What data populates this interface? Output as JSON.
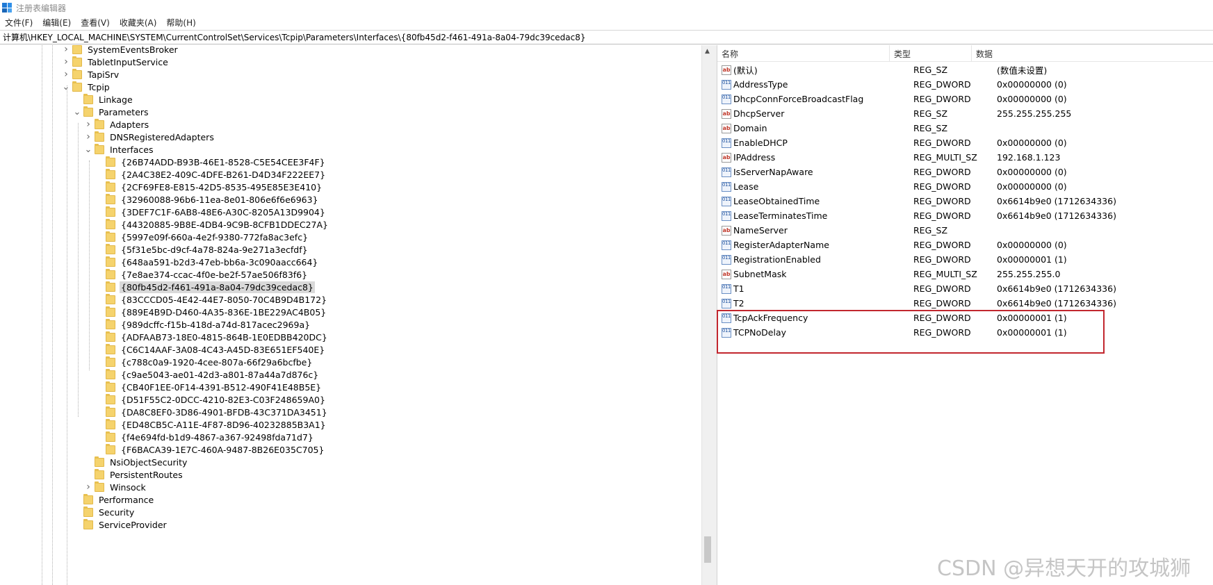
{
  "window": {
    "title": "注册表编辑器"
  },
  "menu": [
    "文件(F)",
    "编辑(E)",
    "查看(V)",
    "收藏夹(A)",
    "帮助(H)"
  ],
  "address": "计算机\\HKEY_LOCAL_MACHINE\\SYSTEM\\CurrentControlSet\\Services\\Tcpip\\Parameters\\Interfaces\\{80fb45d2-f461-491a-8a04-79dc39cedac8}",
  "tree": [
    {
      "label": "SystemEventsBroker",
      "depth": 0,
      "expander": "collapsed"
    },
    {
      "label": "TabletInputService",
      "depth": 0,
      "expander": "collapsed"
    },
    {
      "label": "TapiSrv",
      "depth": 0,
      "expander": "collapsed"
    },
    {
      "label": "Tcpip",
      "depth": 0,
      "expander": "expanded"
    },
    {
      "label": "Linkage",
      "depth": 1,
      "expander": "none"
    },
    {
      "label": "Parameters",
      "depth": 1,
      "expander": "expanded"
    },
    {
      "label": "Adapters",
      "depth": 2,
      "expander": "collapsed"
    },
    {
      "label": "DNSRegisteredAdapters",
      "depth": 2,
      "expander": "collapsed"
    },
    {
      "label": "Interfaces",
      "depth": 2,
      "expander": "expanded"
    },
    {
      "label": "{26B74ADD-B93B-46E1-8528-C5E54CEE3F4F}",
      "depth": 3,
      "expander": "none"
    },
    {
      "label": "{2A4C38E2-409C-4DFE-B261-D4D34F222EE7}",
      "depth": 3,
      "expander": "none"
    },
    {
      "label": "{2CF69FE8-E815-42D5-8535-495E85E3E410}",
      "depth": 3,
      "expander": "none"
    },
    {
      "label": "{32960088-96b6-11ea-8e01-806e6f6e6963}",
      "depth": 3,
      "expander": "none"
    },
    {
      "label": "{3DEF7C1F-6AB8-48E6-A30C-8205A13D9904}",
      "depth": 3,
      "expander": "none"
    },
    {
      "label": "{44320885-9B8E-4DB4-9C9B-8CFB1DDEC27A}",
      "depth": 3,
      "expander": "none"
    },
    {
      "label": "{5997e09f-660a-4e2f-9380-772fa8ac3efc}",
      "depth": 3,
      "expander": "none"
    },
    {
      "label": "{5f31e5bc-d9cf-4a78-824a-9e271a3ecfdf}",
      "depth": 3,
      "expander": "none"
    },
    {
      "label": "{648aa591-b2d3-47eb-bb6a-3c090aacc664}",
      "depth": 3,
      "expander": "none"
    },
    {
      "label": "{7e8ae374-ccac-4f0e-be2f-57ae506f83f6}",
      "depth": 3,
      "expander": "none"
    },
    {
      "label": "{80fb45d2-f461-491a-8a04-79dc39cedac8}",
      "depth": 3,
      "expander": "none",
      "selected": true
    },
    {
      "label": "{83CCCD05-4E42-44E7-8050-70C4B9D4B172}",
      "depth": 3,
      "expander": "none"
    },
    {
      "label": "{889E4B9D-D460-4A35-836E-1BE229AC4B05}",
      "depth": 3,
      "expander": "none"
    },
    {
      "label": "{989dcffc-f15b-418d-a74d-817acec2969a}",
      "depth": 3,
      "expander": "none"
    },
    {
      "label": "{ADFAAB73-18E0-4815-864B-1E0EDBB420DC}",
      "depth": 3,
      "expander": "none"
    },
    {
      "label": "{C6C14AAF-3A08-4C43-A45D-83E651EF540E}",
      "depth": 3,
      "expander": "none"
    },
    {
      "label": "{c788c0a9-1920-4cee-807a-66f29a6bcfbe}",
      "depth": 3,
      "expander": "none"
    },
    {
      "label": "{c9ae5043-ae01-42d3-a801-87a44a7d876c}",
      "depth": 3,
      "expander": "none"
    },
    {
      "label": "{CB40F1EE-0F14-4391-B512-490F41E48B5E}",
      "depth": 3,
      "expander": "none"
    },
    {
      "label": "{D51F55C2-0DCC-4210-82E3-C03F248659A0}",
      "depth": 3,
      "expander": "none"
    },
    {
      "label": "{DA8C8EF0-3D86-4901-BFDB-43C371DA3451}",
      "depth": 3,
      "expander": "none"
    },
    {
      "label": "{ED48CB5C-A11E-4F87-8D96-40232885B3A1}",
      "depth": 3,
      "expander": "none"
    },
    {
      "label": "{f4e694fd-b1d9-4867-a367-92498fda71d7}",
      "depth": 3,
      "expander": "none"
    },
    {
      "label": "{F6BACA39-1E7C-460A-9487-8B26E035C705}",
      "depth": 3,
      "expander": "none"
    },
    {
      "label": "NsiObjectSecurity",
      "depth": 2,
      "expander": "none"
    },
    {
      "label": "PersistentRoutes",
      "depth": 2,
      "expander": "none"
    },
    {
      "label": "Winsock",
      "depth": 2,
      "expander": "collapsed"
    },
    {
      "label": "Performance",
      "depth": 1,
      "expander": "none"
    },
    {
      "label": "Security",
      "depth": 1,
      "expander": "none"
    },
    {
      "label": "ServiceProvider",
      "depth": 1,
      "expander": "none"
    }
  ],
  "list": {
    "columns": [
      "名称",
      "类型",
      "数据"
    ],
    "rows": [
      {
        "icon": "ab",
        "name": "(默认)",
        "type": "REG_SZ",
        "data": "(数值未设置)"
      },
      {
        "icon": "bin",
        "name": "AddressType",
        "type": "REG_DWORD",
        "data": "0x00000000 (0)"
      },
      {
        "icon": "bin",
        "name": "DhcpConnForceBroadcastFlag",
        "type": "REG_DWORD",
        "data": "0x00000000 (0)"
      },
      {
        "icon": "ab",
        "name": "DhcpServer",
        "type": "REG_SZ",
        "data": "255.255.255.255"
      },
      {
        "icon": "ab",
        "name": "Domain",
        "type": "REG_SZ",
        "data": ""
      },
      {
        "icon": "bin",
        "name": "EnableDHCP",
        "type": "REG_DWORD",
        "data": "0x00000000 (0)"
      },
      {
        "icon": "ab",
        "name": "IPAddress",
        "type": "REG_MULTI_SZ",
        "data": "192.168.1.123"
      },
      {
        "icon": "bin",
        "name": "IsServerNapAware",
        "type": "REG_DWORD",
        "data": "0x00000000 (0)"
      },
      {
        "icon": "bin",
        "name": "Lease",
        "type": "REG_DWORD",
        "data": "0x00000000 (0)"
      },
      {
        "icon": "bin",
        "name": "LeaseObtainedTime",
        "type": "REG_DWORD",
        "data": "0x6614b9e0 (1712634336)"
      },
      {
        "icon": "bin",
        "name": "LeaseTerminatesTime",
        "type": "REG_DWORD",
        "data": "0x6614b9e0 (1712634336)"
      },
      {
        "icon": "ab",
        "name": "NameServer",
        "type": "REG_SZ",
        "data": ""
      },
      {
        "icon": "bin",
        "name": "RegisterAdapterName",
        "type": "REG_DWORD",
        "data": "0x00000000 (0)"
      },
      {
        "icon": "bin",
        "name": "RegistrationEnabled",
        "type": "REG_DWORD",
        "data": "0x00000001 (1)"
      },
      {
        "icon": "ab",
        "name": "SubnetMask",
        "type": "REG_MULTI_SZ",
        "data": "255.255.255.0"
      },
      {
        "icon": "bin",
        "name": "T1",
        "type": "REG_DWORD",
        "data": "0x6614b9e0 (1712634336)"
      },
      {
        "icon": "bin",
        "name": "T2",
        "type": "REG_DWORD",
        "data": "0x6614b9e0 (1712634336)"
      },
      {
        "icon": "bin",
        "name": "TcpAckFrequency",
        "type": "REG_DWORD",
        "data": "0x00000001 (1)"
      },
      {
        "icon": "bin",
        "name": "TCPNoDelay",
        "type": "REG_DWORD",
        "data": "0x00000001 (1)"
      }
    ]
  },
  "icons": {
    "ab": "string-value-icon",
    "bin": "binary-value-icon",
    "folder": "folder-icon"
  },
  "colors": {
    "highlight_border": "#c2262e",
    "folder": "#f5d36d",
    "selection": "#d9d9d9"
  },
  "watermark": "CSDN @异想天开的攻城狮"
}
